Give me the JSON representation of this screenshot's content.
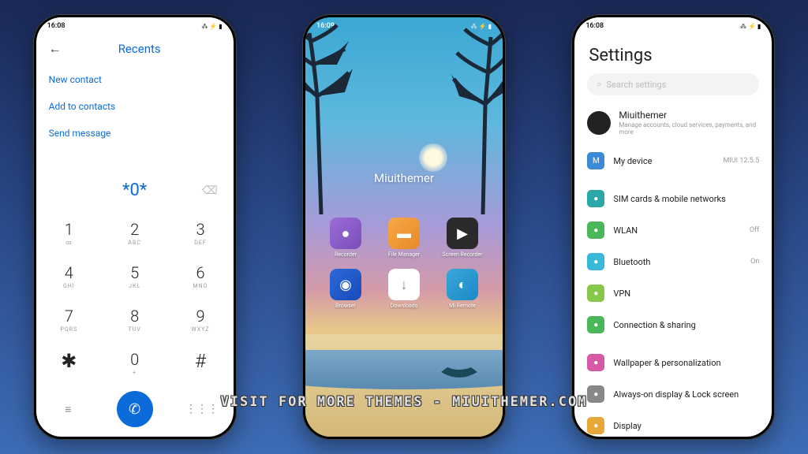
{
  "statusbar": {
    "time1": "16:08",
    "time2": "16:09",
    "time3": "16:08",
    "icons": "⁂ ⚡ ▮"
  },
  "dialer": {
    "title": "Recents",
    "menu": [
      "New contact",
      "Add to contacts",
      "Send message"
    ],
    "display": "*0*",
    "keys": [
      {
        "n": "1",
        "s": "∞"
      },
      {
        "n": "2",
        "s": "ABC"
      },
      {
        "n": "3",
        "s": "DEF"
      },
      {
        "n": "4",
        "s": "GHI"
      },
      {
        "n": "5",
        "s": "JKL"
      },
      {
        "n": "6",
        "s": "MNO"
      },
      {
        "n": "7",
        "s": "PQRS"
      },
      {
        "n": "8",
        "s": "TUV"
      },
      {
        "n": "9",
        "s": "WXYZ"
      },
      {
        "n": "✱",
        "s": ""
      },
      {
        "n": "0",
        "s": "+"
      },
      {
        "n": "#",
        "s": ""
      }
    ]
  },
  "home": {
    "widget": "Miuithemer",
    "apps": [
      {
        "label": "Recorder",
        "cls": "ic-purple",
        "glyph": "●"
      },
      {
        "label": "File Manager",
        "cls": "ic-orange",
        "glyph": "▬"
      },
      {
        "label": "Screen Recorder",
        "cls": "ic-dark",
        "glyph": "▶"
      },
      {
        "label": "Browser",
        "cls": "ic-blue",
        "glyph": "◉"
      },
      {
        "label": "Downloads",
        "cls": "ic-white",
        "glyph": "↓"
      },
      {
        "label": "Mi Remote",
        "cls": "ic-cyan",
        "glyph": "◐"
      }
    ]
  },
  "settings": {
    "title": "Settings",
    "search_placeholder": "Search settings",
    "account": {
      "name": "Miuithemer",
      "sub": "Manage accounts, cloud services, payments, and more"
    },
    "mydevice": {
      "label": "My device",
      "value": "MIUI 12.5.5"
    },
    "rows": [
      {
        "icon": "si-teal",
        "label": "SIM cards & mobile networks",
        "value": ""
      },
      {
        "icon": "si-green",
        "label": "WLAN",
        "value": "Off"
      },
      {
        "icon": "si-cyan",
        "label": "Bluetooth",
        "value": "On"
      },
      {
        "icon": "si-lime",
        "label": "VPN",
        "value": ""
      },
      {
        "icon": "si-green",
        "label": "Connection & sharing",
        "value": ""
      }
    ],
    "rows2": [
      {
        "icon": "si-pink",
        "label": "Wallpaper & personalization",
        "value": ""
      },
      {
        "icon": "si-gray",
        "label": "Always-on display & Lock screen",
        "value": ""
      },
      {
        "icon": "si-orange",
        "label": "Display",
        "value": ""
      }
    ]
  },
  "watermark": "VISIT FOR MORE THEMES - MIUITHEMER.COM"
}
